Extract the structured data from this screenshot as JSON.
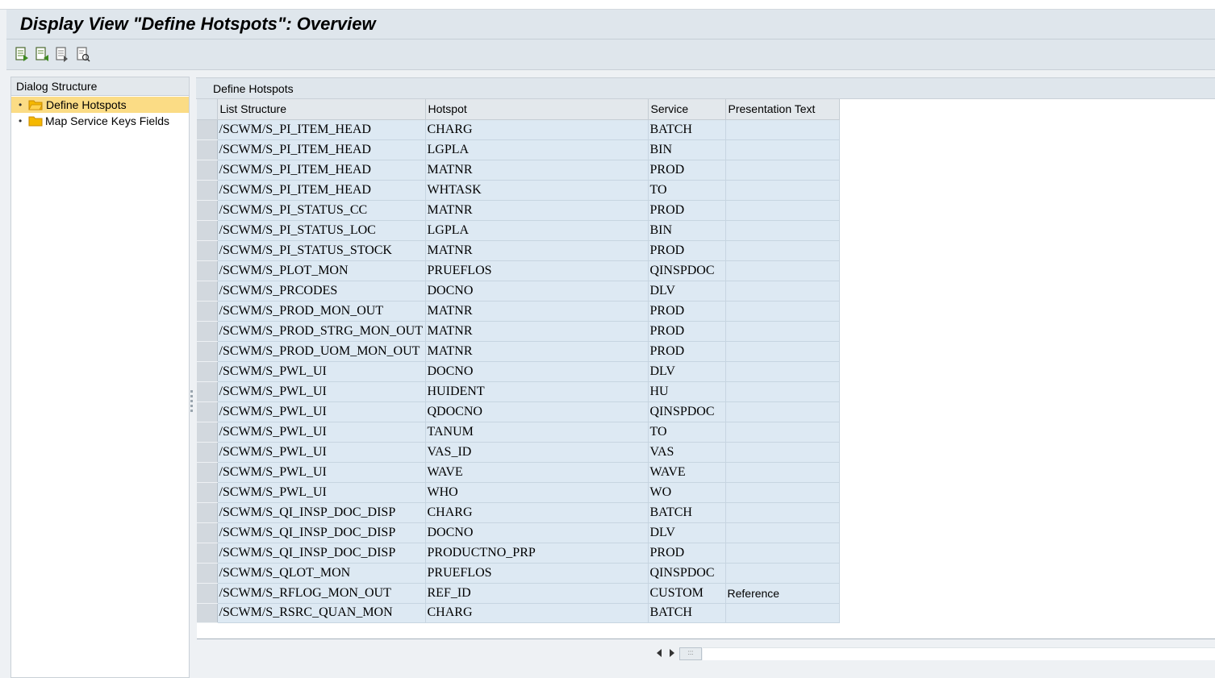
{
  "window": {
    "title": "Display View \"Define Hotspots\": Overview"
  },
  "toolbar": {
    "buttons": [
      {
        "icon": "export-doc-icon"
      },
      {
        "icon": "import-doc-icon"
      },
      {
        "icon": "copy-doc-icon"
      },
      {
        "icon": "where-used-icon"
      }
    ]
  },
  "dialog_structure": {
    "header": "Dialog Structure",
    "items": [
      {
        "label": "Define Hotspots",
        "selected": true
      },
      {
        "label": "Map Service Keys Fields",
        "selected": false
      }
    ]
  },
  "main": {
    "header": "Define Hotspots",
    "columns": [
      "List Structure",
      "Hotspot",
      "Service",
      "Presentation Text"
    ],
    "rows": [
      [
        "/SCWM/S_PI_ITEM_HEAD",
        "CHARG",
        "BATCH",
        ""
      ],
      [
        "/SCWM/S_PI_ITEM_HEAD",
        "LGPLA",
        "BIN",
        ""
      ],
      [
        "/SCWM/S_PI_ITEM_HEAD",
        "MATNR",
        "PROD",
        ""
      ],
      [
        "/SCWM/S_PI_ITEM_HEAD",
        "WHTASK",
        "TO",
        ""
      ],
      [
        "/SCWM/S_PI_STATUS_CC",
        "MATNR",
        "PROD",
        ""
      ],
      [
        "/SCWM/S_PI_STATUS_LOC",
        "LGPLA",
        "BIN",
        ""
      ],
      [
        "/SCWM/S_PI_STATUS_STOCK",
        "MATNR",
        "PROD",
        ""
      ],
      [
        "/SCWM/S_PLOT_MON",
        "PRUEFLOS",
        "QINSPDOC",
        ""
      ],
      [
        "/SCWM/S_PRCODES",
        "DOCNO",
        "DLV",
        ""
      ],
      [
        "/SCWM/S_PROD_MON_OUT",
        "MATNR",
        "PROD",
        ""
      ],
      [
        "/SCWM/S_PROD_STRG_MON_OUT",
        "MATNR",
        "PROD",
        ""
      ],
      [
        "/SCWM/S_PROD_UOM_MON_OUT",
        "MATNR",
        "PROD",
        ""
      ],
      [
        "/SCWM/S_PWL_UI",
        "DOCNO",
        "DLV",
        ""
      ],
      [
        "/SCWM/S_PWL_UI",
        "HUIDENT",
        "HU",
        ""
      ],
      [
        "/SCWM/S_PWL_UI",
        "QDOCNO",
        "QINSPDOC",
        ""
      ],
      [
        "/SCWM/S_PWL_UI",
        "TANUM",
        "TO",
        ""
      ],
      [
        "/SCWM/S_PWL_UI",
        "VAS_ID",
        "VAS",
        ""
      ],
      [
        "/SCWM/S_PWL_UI",
        "WAVE",
        "WAVE",
        ""
      ],
      [
        "/SCWM/S_PWL_UI",
        "WHO",
        "WO",
        ""
      ],
      [
        "/SCWM/S_QI_INSP_DOC_DISP",
        "CHARG",
        "BATCH",
        ""
      ],
      [
        "/SCWM/S_QI_INSP_DOC_DISP",
        "DOCNO",
        "DLV",
        ""
      ],
      [
        "/SCWM/S_QI_INSP_DOC_DISP",
        "PRODUCTNO_PRP",
        "PROD",
        ""
      ],
      [
        "/SCWM/S_QLOT_MON",
        "PRUEFLOS",
        "QINSPDOC",
        ""
      ],
      [
        "/SCWM/S_RFLOG_MON_OUT",
        "REF_ID",
        "CUSTOM",
        "Reference"
      ],
      [
        "/SCWM/S_RSRC_QUAN_MON",
        "CHARG",
        "BATCH",
        ""
      ]
    ]
  },
  "colors": {
    "header_bg": "#dfe6ec",
    "cell_bg": "#dde9f3",
    "selected_tree_bg": "#fbdc85",
    "folder": "#f5b800"
  }
}
